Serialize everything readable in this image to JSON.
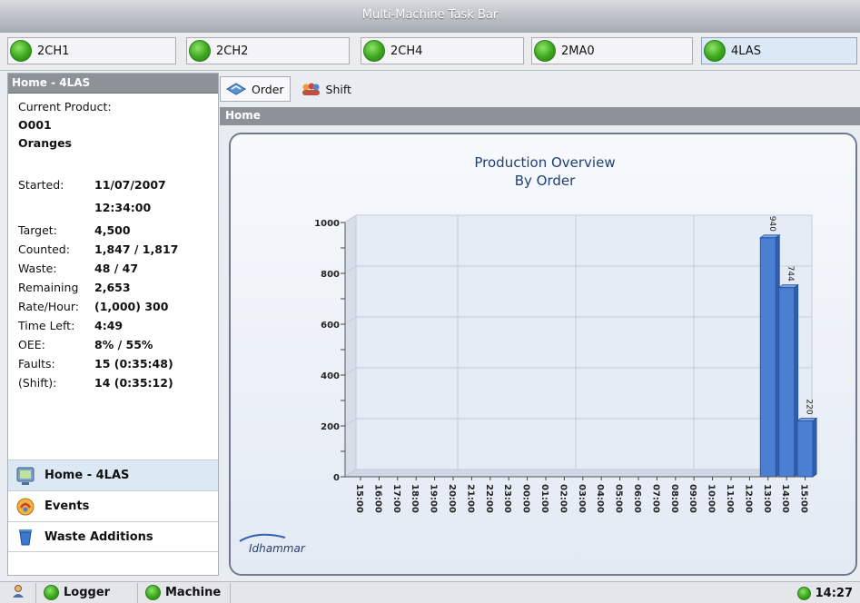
{
  "window": {
    "title": "Multi-Machine Task Bar"
  },
  "machines": [
    {
      "label": "2CH1",
      "status_color": "#3aa61c"
    },
    {
      "label": "2CH2",
      "status_color": "#3aa61c"
    },
    {
      "label": "2CH4",
      "status_color": "#3aa61c"
    },
    {
      "label": "2MA0",
      "status_color": "#3aa61c"
    },
    {
      "label": "4LAS",
      "status_color": "#3aa61c",
      "active": true
    }
  ],
  "left_panel": {
    "header": "Home - 4LAS",
    "current_product_label": "Current Product:",
    "product_code": "O001",
    "product_name": "Oranges",
    "stats": [
      {
        "label": "Started:",
        "value": "11/07/2007"
      },
      {
        "label": "",
        "value": "12:34:00"
      },
      {
        "label": "Target:",
        "value": "4,500"
      },
      {
        "label": "Counted:",
        "value": "1,847 / 1,817"
      },
      {
        "label": "Waste:",
        "value": "48 / 47"
      },
      {
        "label": "Remaining",
        "value": "2,653"
      },
      {
        "label": "Rate/Hour:",
        "value": "(1,000) 300"
      },
      {
        "label": "Time Left:",
        "value": "4:49"
      },
      {
        "label": "OEE:",
        "value": "8% / 55%"
      },
      {
        "label": "Faults:",
        "value": "15 (0:35:48)"
      },
      {
        "label": " (Shift):",
        "value": "14 (0:35:12)"
      }
    ],
    "nav": [
      {
        "label": "Home - 4LAS",
        "icon": "monitor-icon"
      },
      {
        "label": "Events",
        "icon": "events-icon"
      },
      {
        "label": "Waste Additions",
        "icon": "waste-bin-icon"
      }
    ]
  },
  "view_tabs": [
    {
      "label": "Order",
      "icon": "order-icon",
      "active": true
    },
    {
      "label": "Shift",
      "icon": "shift-icon",
      "active": false
    }
  ],
  "home_bar": "Home",
  "logo_text": "Idhammar",
  "status_bar": {
    "logger_label": "Logger",
    "machine_label": "Machine",
    "time": "14:27"
  },
  "chart_data": {
    "type": "bar",
    "title": "Production Overview",
    "subtitle": "By Order",
    "categories": [
      "15:00",
      "16:00",
      "17:00",
      "18:00",
      "19:00",
      "20:00",
      "21:00",
      "22:00",
      "23:00",
      "00:00",
      "01:00",
      "02:00",
      "03:00",
      "04:00",
      "05:00",
      "06:00",
      "07:00",
      "08:00",
      "09:00",
      "10:00",
      "11:00",
      "12:00",
      "13:00",
      "14:00",
      "15:00"
    ],
    "values": [
      0,
      0,
      0,
      0,
      0,
      0,
      0,
      0,
      0,
      0,
      0,
      0,
      0,
      0,
      0,
      0,
      0,
      0,
      0,
      0,
      0,
      0,
      940,
      744,
      220
    ],
    "data_labels": {
      "22": "940",
      "23": "744",
      "24": "220"
    },
    "ylim": [
      0,
      1000
    ],
    "yticks": [
      0,
      200,
      400,
      600,
      800,
      1000
    ],
    "grid": true,
    "bar_color": "#4b7fd1"
  }
}
